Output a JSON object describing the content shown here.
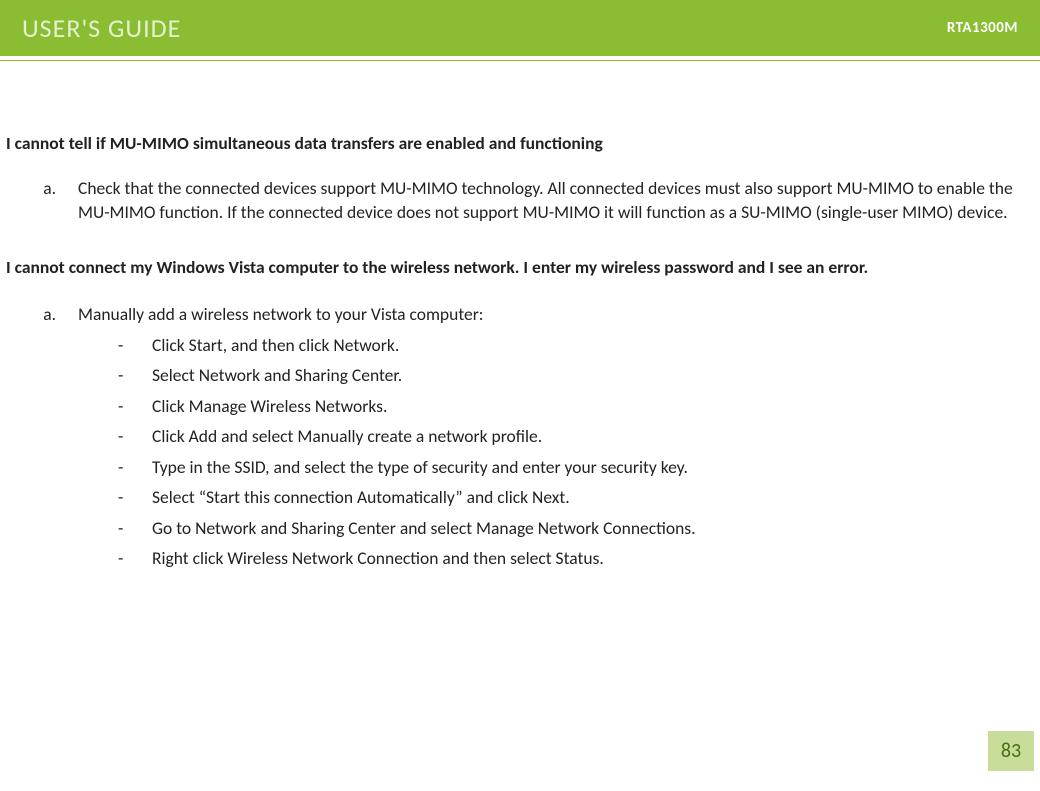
{
  "header": {
    "title": "USER'S GUIDE",
    "model": "RTA1300M"
  },
  "section1": {
    "heading": "I cannot tell if MU-MIMO simultaneous data transfers are enabled and functioning",
    "item_a": "Check that the connected devices support MU-MIMO technology.  All connected devices must also support MU-MIMO to enable the MU-MIMO function.  If the connected device does not support MU-MIMO it will function as a SU-MIMO (single-user MIMO) device."
  },
  "section2": {
    "heading": "I cannot connect my Windows Vista computer to the wireless network.  I enter my wireless password and I see an error.",
    "item_a_intro": "Manually add a wireless network to your Vista computer:",
    "steps": {
      "0": "Click Start, and then click Network.",
      "1": "Select Network and Sharing Center.",
      "2": "Click Manage Wireless Networks.",
      "3": "Click Add and select Manually create a network profile.",
      "4": "Type in the SSID, and select the type of security and enter your security key.",
      "5": "Select “Start this connection Automatically” and click Next.",
      "6": "Go to Network and Sharing Center and select Manage Network Connections.",
      "7": "Right click Wireless Network Connection and then select Status."
    }
  },
  "page_number": "83"
}
